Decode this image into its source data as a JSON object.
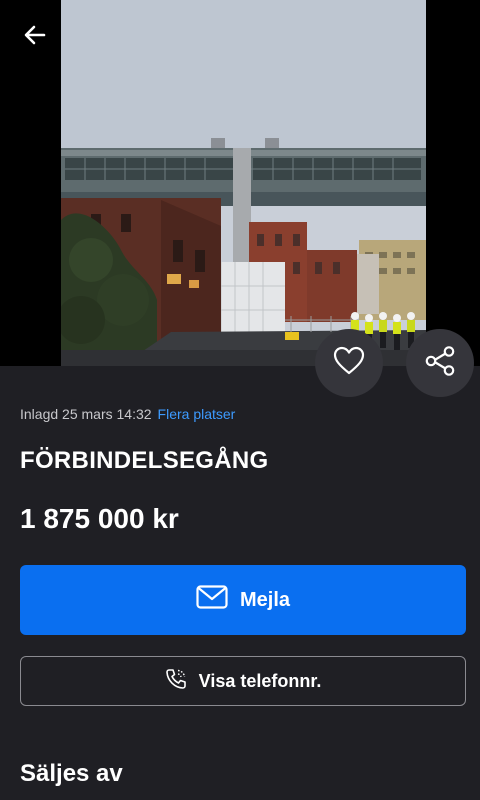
{
  "listing": {
    "posted": "Inlagd 25 mars 14:32",
    "location": "Flera platser",
    "title": "FÖRBINDELSEGÅNG",
    "price": "1 875 000 kr"
  },
  "actions": {
    "email_label": "Mejla",
    "phone_label": "Visa telefonnr."
  },
  "seller": {
    "heading": "Säljes av"
  },
  "icons": {
    "back": "arrow-left-icon",
    "favorite": "heart-icon",
    "share": "share-icon",
    "email": "envelope-icon",
    "phone": "phone-icon"
  },
  "colors": {
    "background": "#1f1f24",
    "accent": "#0a6ff0",
    "link": "#3d9bff"
  }
}
